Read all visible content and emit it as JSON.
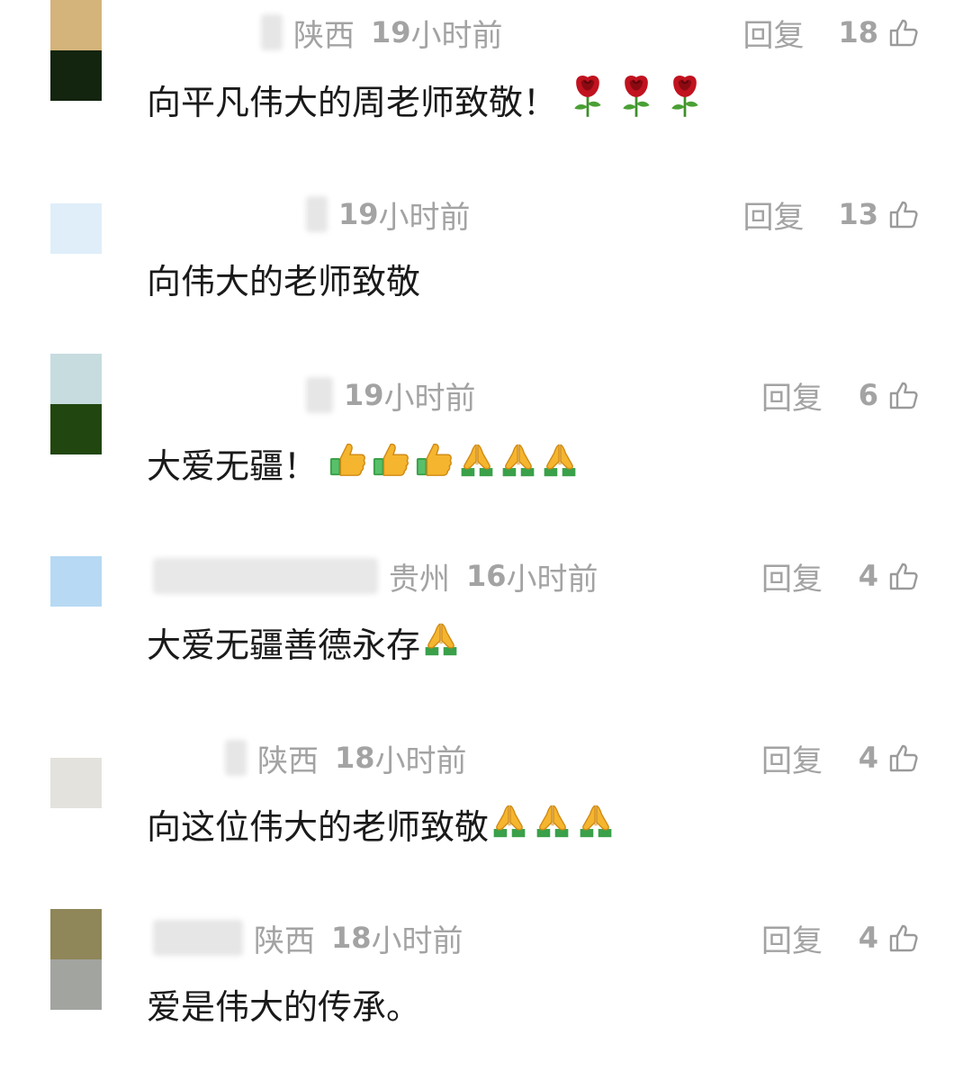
{
  "labels": {
    "reply": "回复"
  },
  "comments": [
    {
      "location": "陕西",
      "time_num": "19",
      "time_unit": "小时前",
      "likes": "18",
      "text": "向平凡伟大的周老师致敬！",
      "emoji": [
        "rose-icon",
        "rose-icon",
        "rose-icon"
      ],
      "avatar_colors": [
        "#d4b47a",
        "#13240f"
      ]
    },
    {
      "location": "",
      "time_num": "19",
      "time_unit": "小时前",
      "likes": "13",
      "text": "向伟大的老师致敬",
      "emoji": [],
      "avatar_colors": [
        "#dfeef9"
      ]
    },
    {
      "location": "",
      "time_num": "19",
      "time_unit": "小时前",
      "likes": "6",
      "text": "大爱无疆！",
      "emoji": [
        "thumbs-up-icon",
        "thumbs-up-icon",
        "thumbs-up-icon",
        "praying-hands-icon",
        "praying-hands-icon",
        "praying-hands-icon"
      ],
      "avatar_colors": [
        "#c7dcdf",
        "#21460f"
      ]
    },
    {
      "location": "贵州",
      "time_num": "16",
      "time_unit": "小时前",
      "likes": "4",
      "text": "大爱无疆善德永存",
      "emoji": [
        "praying-hands-icon"
      ],
      "avatar_colors": [
        "#b7d9f3"
      ]
    },
    {
      "location": "陕西",
      "time_num": "18",
      "time_unit": "小时前",
      "likes": "4",
      "text": "向这位伟大的老师致敬",
      "emoji": [
        "praying-hands-icon",
        "praying-hands-icon",
        "praying-hands-icon"
      ],
      "avatar_colors": [
        "#e3e2dc"
      ]
    },
    {
      "location": "陕西",
      "time_num": "18",
      "time_unit": "小时前",
      "likes": "4",
      "text": "爱是伟大的传承。",
      "emoji": [],
      "avatar_colors": [
        "#8f8659",
        "#a2a4a0"
      ]
    }
  ]
}
